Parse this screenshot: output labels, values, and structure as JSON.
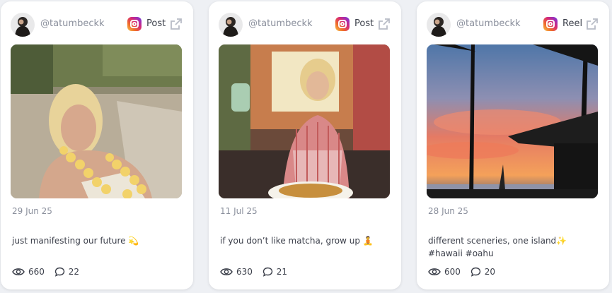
{
  "cards": [
    {
      "handle": "@tatumbeckk",
      "type": "Post",
      "date": "29 Jun 25",
      "caption": "just manifesting our future 💫",
      "views": "660",
      "comments": "22"
    },
    {
      "handle": "@tatumbeckk",
      "type": "Post",
      "date": "11 Jul 25",
      "caption": "if you don’t like matcha, grow up 🧘",
      "views": "630",
      "comments": "21"
    },
    {
      "handle": "@tatumbeckk",
      "type": "Reel",
      "date": "28 Jun 25",
      "caption": "different sceneries, one island✨ #hawaii #oahu",
      "views": "600",
      "comments": "20"
    }
  ]
}
